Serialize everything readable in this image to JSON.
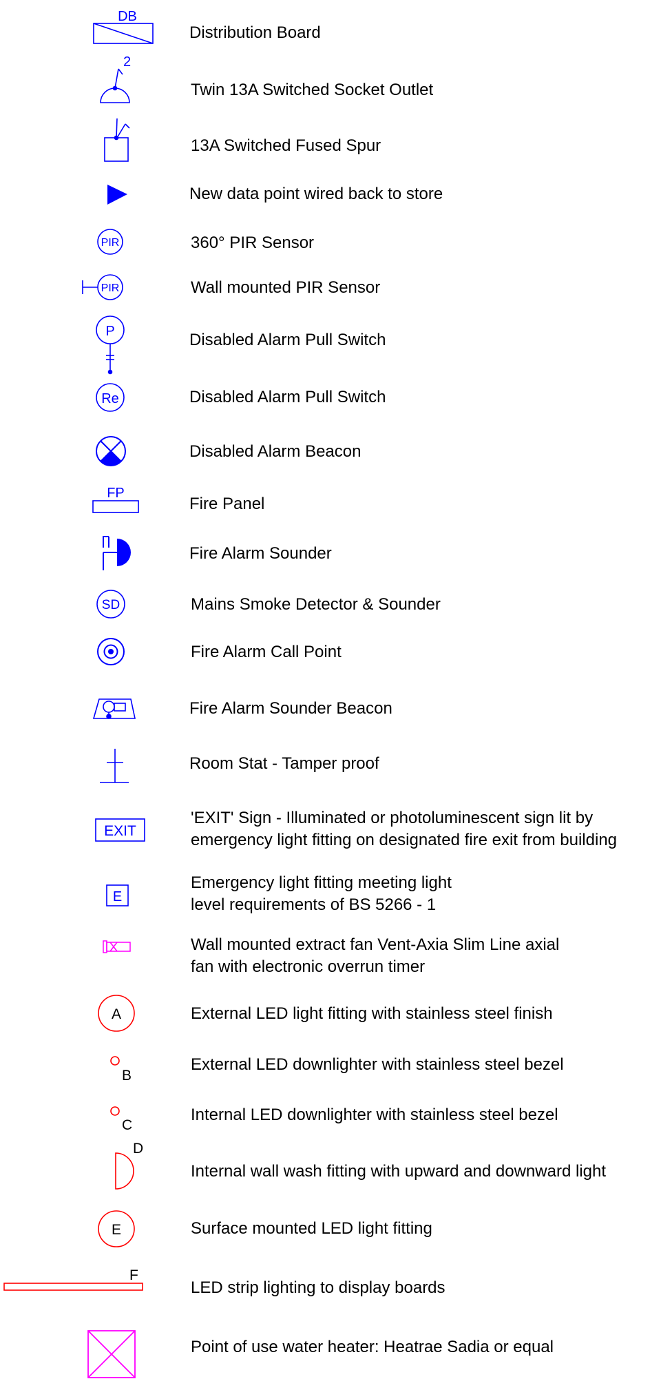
{
  "colors": {
    "blue": "#0000ff",
    "red": "#ff0000",
    "magenta": "#ff00ff",
    "text": "#000000"
  },
  "legend": {
    "items": [
      {
        "symbol": "distribution-board",
        "tag": "DB",
        "label": "Distribution Board"
      },
      {
        "symbol": "twin-socket",
        "tag": "2",
        "label": "Twin 13A Switched Socket Outlet"
      },
      {
        "symbol": "fused-spur",
        "label": "13A Switched Fused Spur"
      },
      {
        "symbol": "data-point",
        "label": "New data point wired back to store"
      },
      {
        "symbol": "pir-sensor",
        "tag": "PIR",
        "label": "360° PIR Sensor"
      },
      {
        "symbol": "wall-pir-sensor",
        "tag": "PIR",
        "label": "Wall mounted PIR Sensor"
      },
      {
        "symbol": "pull-switch",
        "tag": "P",
        "label": "Disabled Alarm Pull Switch"
      },
      {
        "symbol": "reset-switch",
        "tag": "Re",
        "label": "Disabled Alarm Pull Switch"
      },
      {
        "symbol": "alarm-beacon",
        "label": "Disabled Alarm Beacon"
      },
      {
        "symbol": "fire-panel",
        "tag": "FP",
        "label": "Fire Panel"
      },
      {
        "symbol": "fire-sounder",
        "label": "Fire Alarm Sounder"
      },
      {
        "symbol": "smoke-detector",
        "tag": "SD",
        "label": "Mains Smoke Detector & Sounder"
      },
      {
        "symbol": "call-point",
        "label": "Fire Alarm Call Point"
      },
      {
        "symbol": "sounder-beacon",
        "label": "Fire Alarm Sounder Beacon"
      },
      {
        "symbol": "room-stat",
        "label": "Room Stat - Tamper proof"
      },
      {
        "symbol": "exit-sign",
        "tag": "EXIT",
        "label_line1": "'EXIT' Sign - Illuminated or photoluminescent sign lit by",
        "label_line2": "emergency light fitting on designated fire exit from building"
      },
      {
        "symbol": "emergency-light",
        "tag": "E",
        "label_line1": "Emergency light fitting meeting light",
        "label_line2": "level requirements of BS 5266 - 1"
      },
      {
        "symbol": "extract-fan",
        "label_line1": "Wall mounted extract fan Vent-Axia Slim Line axial",
        "label_line2": "fan with electronic overrun timer"
      },
      {
        "symbol": "light-a",
        "tag": "A",
        "label": "External LED light fitting with stainless steel finish"
      },
      {
        "symbol": "light-b",
        "tag": "B",
        "label": "External LED downlighter with stainless steel bezel"
      },
      {
        "symbol": "light-c",
        "tag": "C",
        "label": "Internal LED downlighter with stainless steel bezel"
      },
      {
        "symbol": "light-d",
        "tag": "D",
        "label": "Internal wall wash fitting with upward and downward light"
      },
      {
        "symbol": "light-e",
        "tag": "E",
        "label": "Surface mounted LED light fitting"
      },
      {
        "symbol": "light-f",
        "tag": "F",
        "label": "LED strip lighting to display boards"
      },
      {
        "symbol": "water-heater",
        "label": "Point of use water heater: Heatrae Sadia or equal"
      }
    ]
  }
}
